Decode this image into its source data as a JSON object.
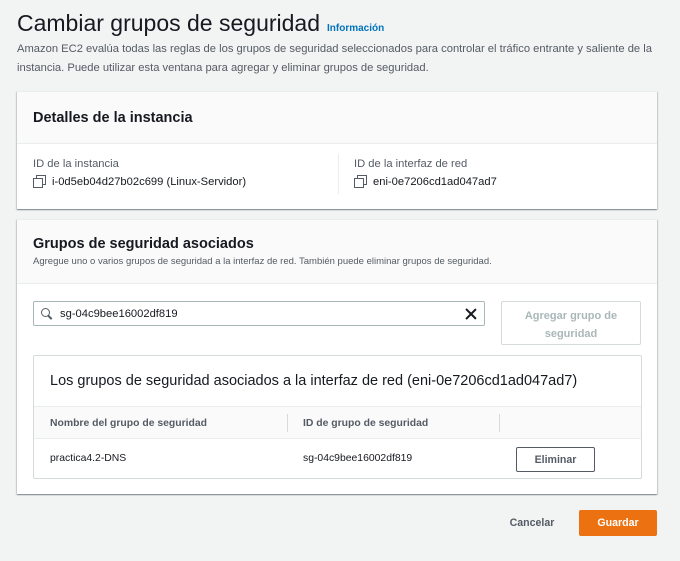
{
  "header": {
    "title": "Cambiar grupos de seguridad",
    "info_link": "Información",
    "description": "Amazon EC2 evalúa todas las reglas de los grupos de seguridad seleccionados para controlar el tráfico entrante y saliente de la instancia. Puede utilizar esta ventana para agregar y eliminar grupos de seguridad."
  },
  "instance_details": {
    "title": "Detalles de la instancia",
    "instance_id_label": "ID de la instancia",
    "instance_id_value": "i-0d5eb04d27b02c699 (Linux-Servidor)",
    "interface_id_label": "ID de la interfaz de red",
    "interface_id_value": "eni-0e7206cd1ad047ad7"
  },
  "security_groups": {
    "title": "Grupos de seguridad asociados",
    "subtitle": "Agregue uno o varios grupos de seguridad a la interfaz de red. También puede eliminar grupos de seguridad.",
    "search_value": "sg-04c9bee16002df819",
    "add_button_line1": "Agregar grupo de",
    "add_button_line2": "seguridad",
    "table": {
      "title": "Los grupos de seguridad asociados a la interfaz de red (eni-0e7206cd1ad047ad7)",
      "columns": [
        "Nombre del grupo de seguridad",
        "ID de grupo de seguridad"
      ],
      "rows": [
        {
          "name": "practica4.2-DNS",
          "id": "sg-04c9bee16002df819",
          "action": "Eliminar"
        }
      ]
    }
  },
  "footer": {
    "cancel_label": "Cancelar",
    "save_label": "Guardar"
  },
  "colors": {
    "background": "#f2f3f3",
    "link": "#0073bb",
    "primary_button": "#ec7211"
  }
}
